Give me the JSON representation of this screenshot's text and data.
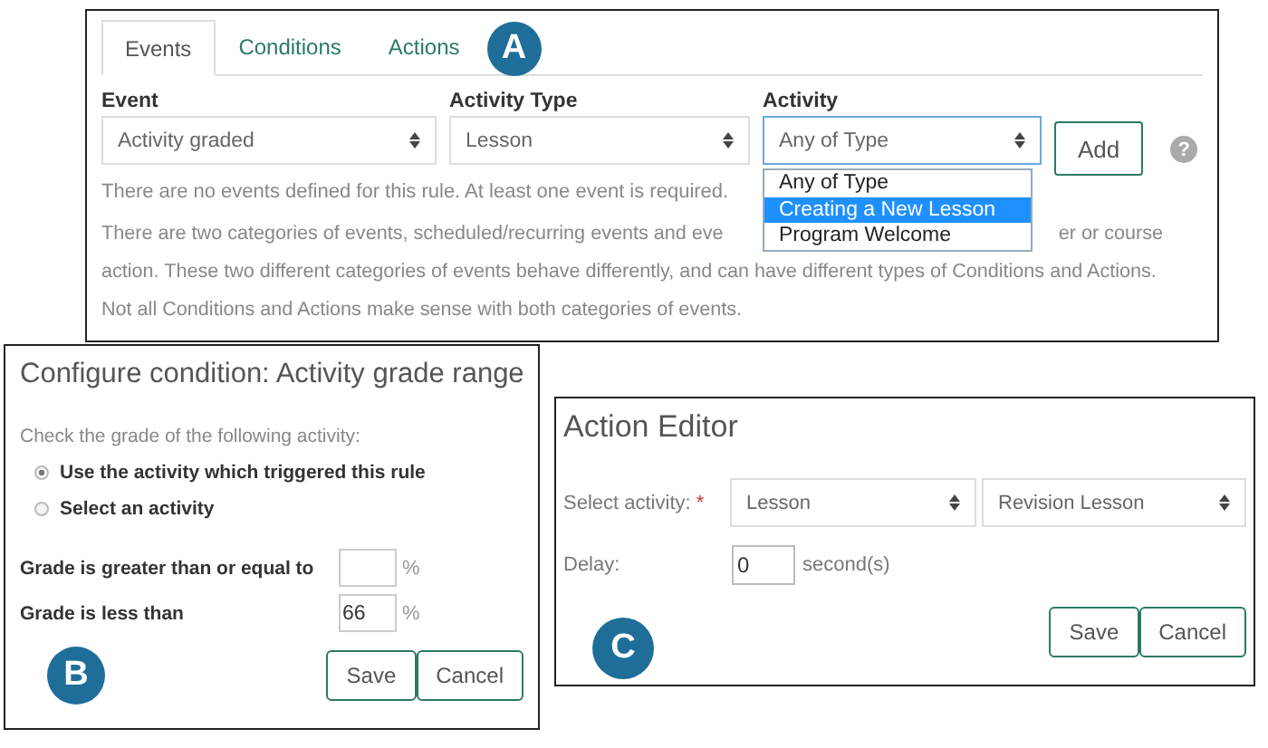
{
  "events_panel": {
    "tabs": [
      {
        "label": "Events",
        "selected": true
      },
      {
        "label": "Conditions",
        "selected": false
      },
      {
        "label": "Actions",
        "selected": false
      }
    ],
    "badge": "A",
    "fields": [
      {
        "label": "Event",
        "value": "Activity graded",
        "focused": false
      },
      {
        "label": "Activity Type",
        "value": "Lesson",
        "focused": false
      },
      {
        "label": "Activity",
        "value": "Any of Type",
        "focused": true
      }
    ],
    "add_button": "Add",
    "help": "?",
    "error": "There are no events defined for this rule. At least one event is required.",
    "dropdown": [
      {
        "label": "Any of Type",
        "selected": false
      },
      {
        "label": "Creating a New Lesson",
        "selected": true
      },
      {
        "label": "Program Welcome",
        "selected": false
      }
    ],
    "description": {
      "line_1_start": "There are two categories of events, scheduled/recurring events and eve",
      "line_1_end": "er or course",
      "rest": "action. These two different categories of events behave differently, and can have different types of Conditions and Actions. Not all Conditions and Actions make sense with both categories of events."
    }
  },
  "condition_panel": {
    "title": "Configure condition: Activity grade range",
    "prompt": "Check the grade of the following activity:",
    "options": [
      {
        "label": "Use the activity which triggered this rule",
        "selected": true
      },
      {
        "label": "Select an activity",
        "selected": false
      }
    ],
    "ranges": [
      {
        "label": "Grade is greater than or equal to",
        "unit": "%"
      },
      {
        "label": "Grade is less than",
        "value": "66",
        "unit": "%"
      }
    ],
    "badge": "B",
    "buttons": [
      "Save",
      "Cancel"
    ]
  },
  "action_panel": {
    "title": "Action Editor",
    "activity_label": "Select activity:",
    "required_mark": "*",
    "selects": [
      "Lesson",
      "Revision Lesson"
    ],
    "delay_label": "Delay:",
    "delay_value": "0",
    "delay_unit": "second(s)",
    "badge": "C",
    "buttons": [
      "Save",
      "Cancel"
    ]
  }
}
